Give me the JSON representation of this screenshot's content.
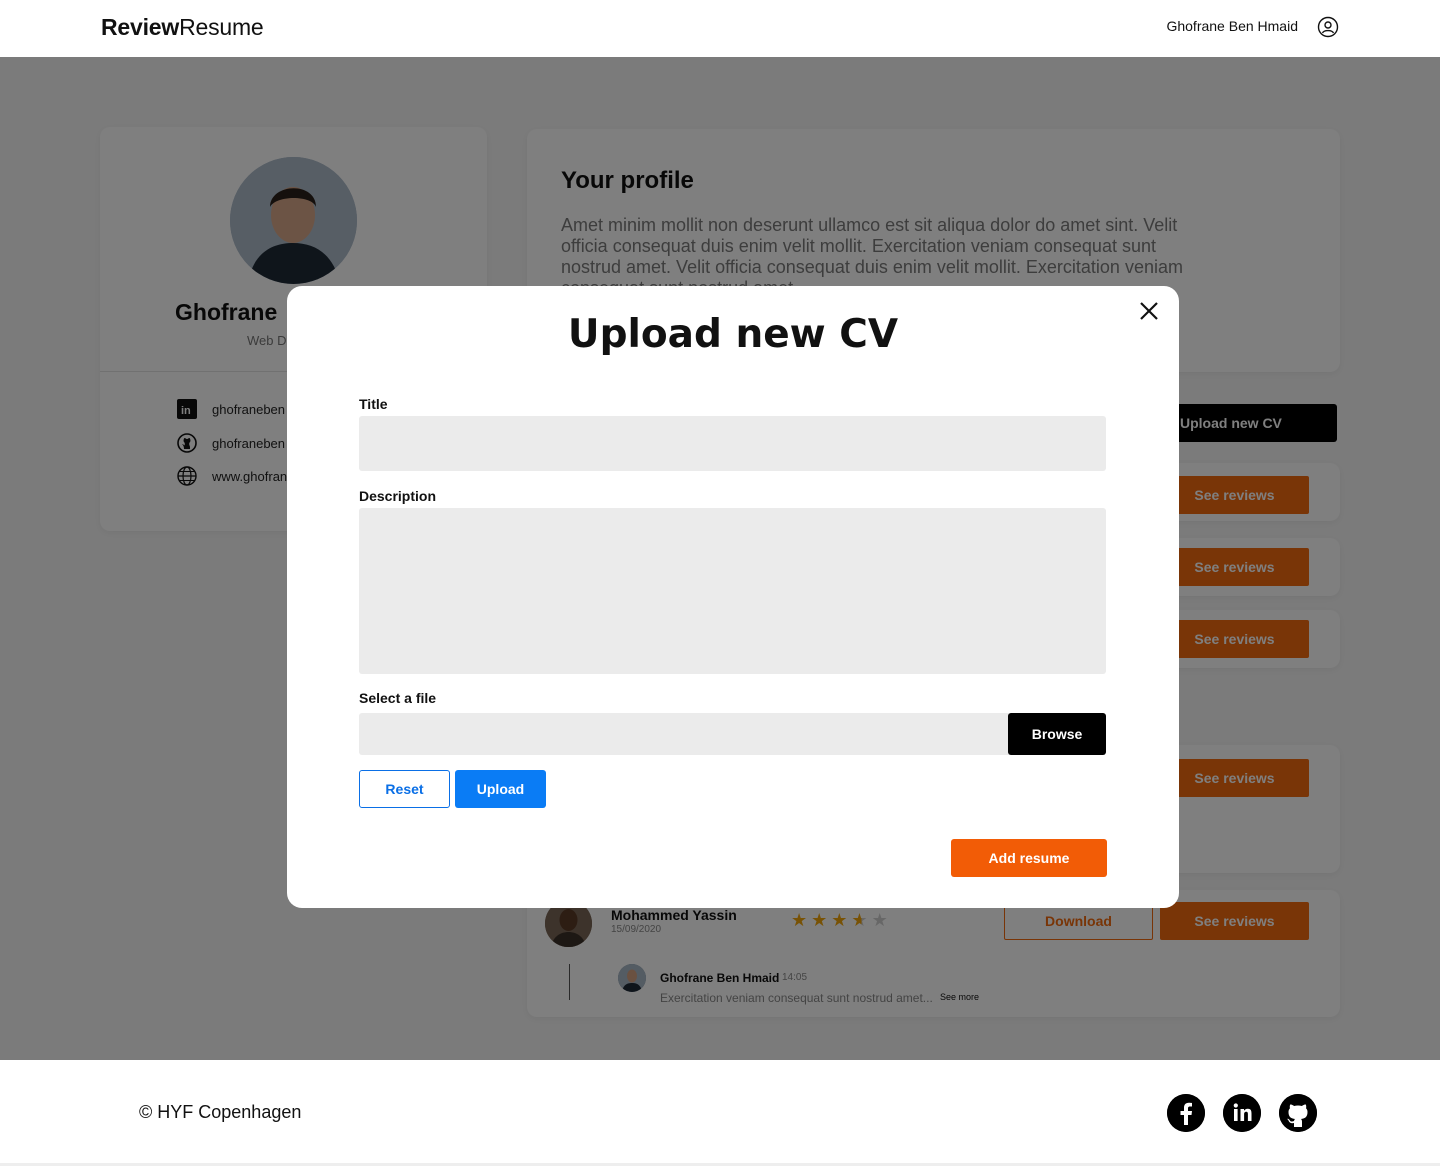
{
  "header": {
    "logo_bold": "Review",
    "logo_light": "Resume",
    "user_name": "Ghofrane Ben Hmaid",
    "user_icon": "user-circle-icon"
  },
  "profile": {
    "name": "Ghofrane",
    "role": "Web D",
    "links": [
      {
        "icon": "linkedin-icon",
        "text": "ghofraneben"
      },
      {
        "icon": "github-icon",
        "text": "ghofraneben"
      },
      {
        "icon": "globe-icon",
        "text": "www.ghofran"
      }
    ]
  },
  "about": {
    "title": "Your profile",
    "text": "Amet minim mollit non deserunt ullamco est sit aliqua dolor do amet sint. Velit officia consequat duis enim velit mollit. Exercitation veniam consequat sunt nostrud amet. Velit officia consequat duis enim velit mollit. Exercitation veniam consequat sunt nostrud amet."
  },
  "actions": {
    "upload_new_cv": "Upload new CV",
    "see_reviews": "See reviews",
    "download": "Download"
  },
  "review": {
    "reviewer": "Mohammed Yassin",
    "date": "15/09/2020",
    "rating": 3.5,
    "rating_max": 5,
    "reply_author": "Ghofrane Ben Hmaid",
    "reply_time": "14:05",
    "reply_text": "Exercitation veniam consequat sunt nostrud amet...",
    "see_more": "See more"
  },
  "modal": {
    "title": "Upload new CV",
    "title_label": "Title",
    "description_label": "Description",
    "file_label": "Select a file",
    "browse": "Browse",
    "reset": "Reset",
    "upload": "Upload",
    "add_resume": "Add resume"
  },
  "footer": {
    "copyright": "©  HYF Copenhagen",
    "icons": [
      "facebook-icon",
      "linkedin-icon",
      "github-icon"
    ]
  },
  "colors": {
    "accent_orange": "#f26b0f",
    "primary_blue": "#0a7cf5",
    "overlay": "rgba(0,0,0,0.5)"
  }
}
